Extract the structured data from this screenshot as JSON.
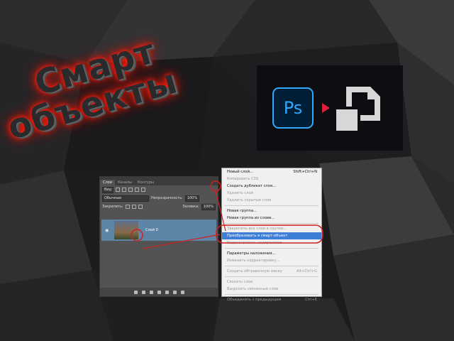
{
  "title": {
    "line1": "Смарт",
    "line2": "объекты"
  },
  "logo": {
    "ps_text": "Ps",
    "ps_color": "#31a8ff",
    "arrow_color": "#e0203a",
    "smart_icon": "smart-object-icon"
  },
  "panel": {
    "tabs": [
      "Слои",
      "Каналы",
      "Контуры"
    ],
    "filter_select": "Вид",
    "blend_select": "Обычные",
    "opacity_label": "Непрозрачность:",
    "opacity_value": "100%",
    "lock_label": "Закрепить:",
    "fill_label": "Заливка:",
    "fill_value": "100%",
    "layer_name": "Слой 0",
    "menu_button": "≡"
  },
  "menu": {
    "items": [
      {
        "label": "Новый слой...",
        "shortcut": "Shift+Ctrl+N",
        "disabled": false
      },
      {
        "label": "Копировать CSS",
        "shortcut": "",
        "disabled": true
      },
      {
        "label": "Создать дубликат слоя...",
        "shortcut": "",
        "disabled": false
      },
      {
        "label": "Удалить слой",
        "shortcut": "",
        "disabled": true
      },
      {
        "label": "Удалить скрытые слои",
        "shortcut": "",
        "disabled": true
      },
      {
        "label": "Новая группа...",
        "shortcut": "",
        "disabled": false
      },
      {
        "label": "Новая группа из слоев...",
        "shortcut": "",
        "disabled": false
      },
      {
        "label": "Закрепить все слои в группе...",
        "shortcut": "",
        "disabled": true
      },
      {
        "label": "Преобразовать в смарт-объект",
        "shortcut": "",
        "disabled": false,
        "highlighted": true
      },
      {
        "label": "Редактировать содержимое",
        "shortcut": "",
        "disabled": true
      },
      {
        "label": "Параметры наложения...",
        "shortcut": "",
        "disabled": false
      },
      {
        "label": "Изменить корректировку...",
        "shortcut": "",
        "disabled": true
      },
      {
        "label": "Создать обтравочную маску",
        "shortcut": "Alt+Ctrl+G",
        "disabled": true
      },
      {
        "label": "Связать слои",
        "shortcut": "",
        "disabled": true
      },
      {
        "label": "Выделить связанные слои",
        "shortcut": "",
        "disabled": true
      },
      {
        "label": "Объединить с предыдущим",
        "shortcut": "Ctrl+E",
        "disabled": true
      }
    ]
  }
}
